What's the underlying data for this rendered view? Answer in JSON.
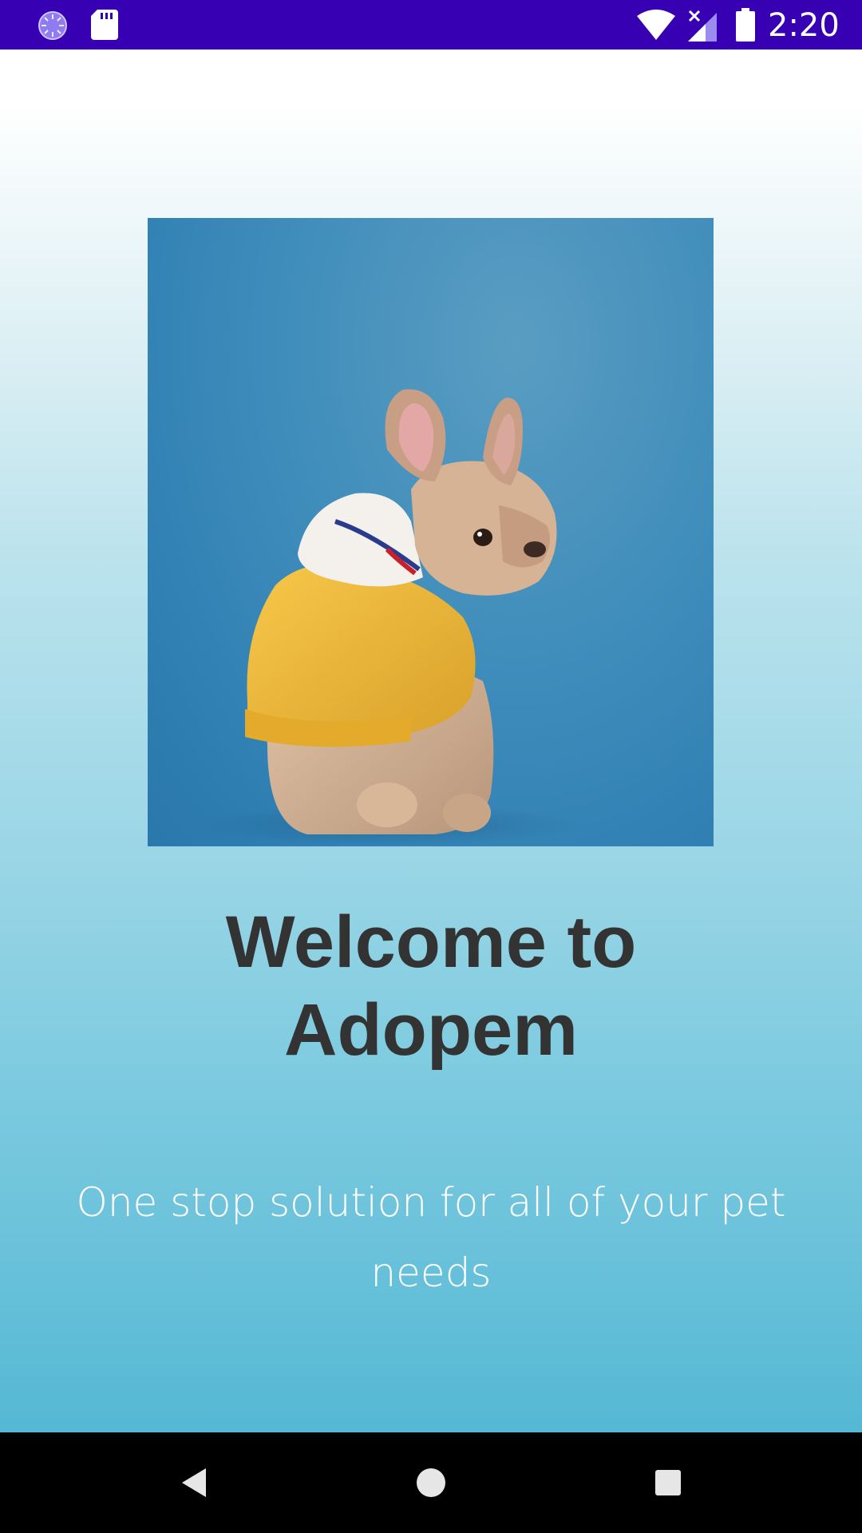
{
  "status_bar": {
    "time": "2:20",
    "background_color": "#3700b3",
    "left_icons": [
      "loader-icon",
      "sd-card-icon"
    ],
    "right_icons": [
      "wifi-icon",
      "cellular-signal-icon",
      "battery-icon"
    ]
  },
  "hero": {
    "image_subject": "French bulldog in yellow hoodie on blue background"
  },
  "welcome": {
    "title_line1": "Welcome to",
    "title_line2": "Adopem",
    "subtitle": "One stop solution for all of your pet needs",
    "title_color": "#333333",
    "subtitle_color": "#ffffff"
  },
  "nav_bar": {
    "buttons": [
      "back-icon",
      "home-icon",
      "recents-icon"
    ]
  }
}
